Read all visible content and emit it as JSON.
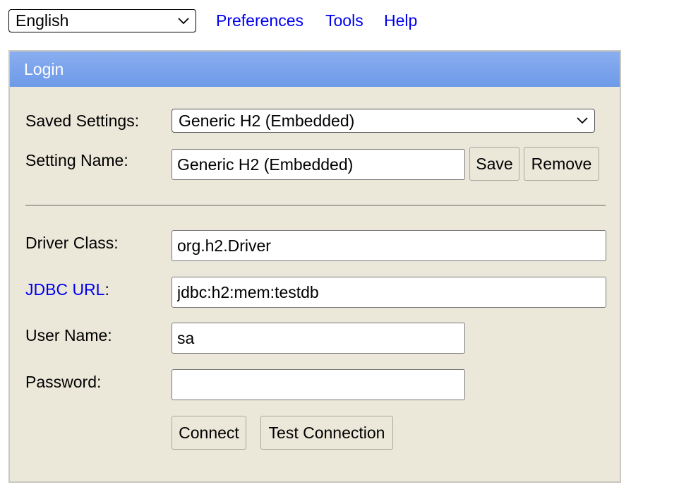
{
  "top_bar": {
    "language_selected": "English",
    "links": {
      "preferences": "Preferences",
      "tools": "Tools",
      "help": "Help"
    }
  },
  "login": {
    "header_title": "Login",
    "saved_settings": {
      "label": "Saved Settings:",
      "selected": "Generic H2 (Embedded)"
    },
    "setting_name": {
      "label": "Setting Name:",
      "value": "Generic H2 (Embedded)",
      "save_label": "Save",
      "remove_label": "Remove"
    },
    "driver_class": {
      "label": "Driver Class:",
      "value": "org.h2.Driver"
    },
    "jdbc_url": {
      "link_label": "JDBC URL",
      "suffix": ":",
      "value": "jdbc:h2:mem:testdb"
    },
    "user_name": {
      "label": "User Name:",
      "value": "sa"
    },
    "password": {
      "label": "Password:",
      "value": ""
    },
    "buttons": {
      "connect": "Connect",
      "test_connection": "Test Connection"
    }
  }
}
